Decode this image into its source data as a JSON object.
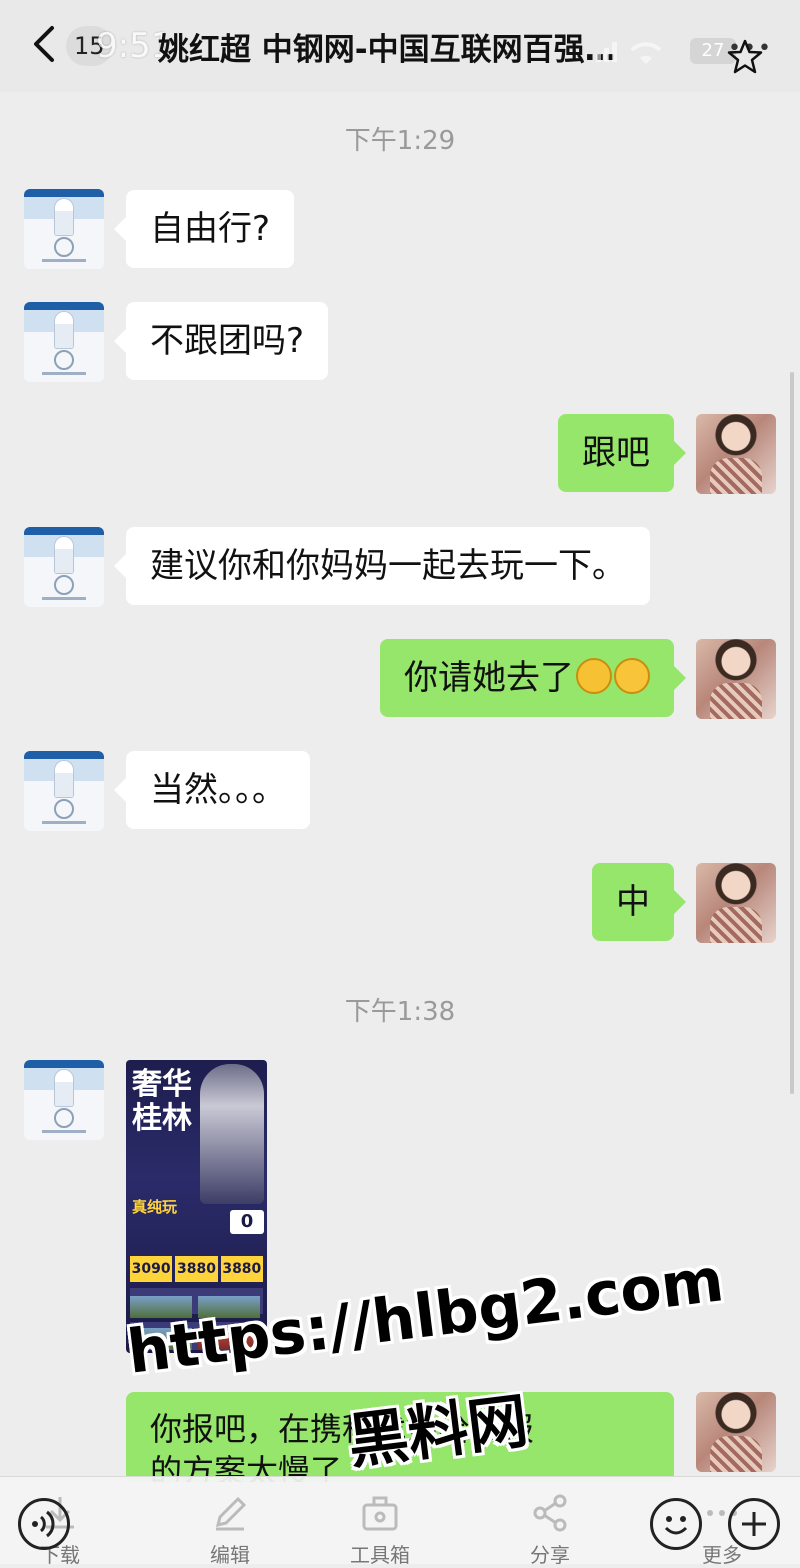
{
  "header": {
    "back_count": "15",
    "status_time": "9:51",
    "title": "姚红超 中钢网-中国互联网百强…",
    "battery": "27"
  },
  "messages": {
    "time1": "下午1:29",
    "m1": "自由行?",
    "m2": "不跟团吗?",
    "m3": "跟吧",
    "m4": "建议你和你妈妈一起去玩一下。",
    "m5_text": "你请她去了",
    "m5_emojis": [
      "grinning-emoji",
      "laughing-tears-emoji"
    ],
    "m6": "当然。。。",
    "m7": "中",
    "time2": "下午1:38",
    "poster": {
      "title": "奢华\n桂林",
      "subtitle": "真纯玩",
      "badge": "0",
      "prices": [
        "3090",
        "3880",
        "3880"
      ]
    },
    "m9_line1": "你报吧，在携程找她给我报",
    "m9_line2": "的方案太慢了"
  },
  "watermark": {
    "url": "https://hlbg2.com",
    "name": "黑料网"
  },
  "toolbar": {
    "items": [
      {
        "label": "下载",
        "icon": "download-icon"
      },
      {
        "label": "编辑",
        "icon": "edit-icon"
      },
      {
        "label": "工具箱",
        "icon": "toolbox-icon"
      },
      {
        "label": "分享",
        "icon": "share-icon"
      },
      {
        "label": "更多",
        "icon": "more-icon"
      }
    ]
  }
}
